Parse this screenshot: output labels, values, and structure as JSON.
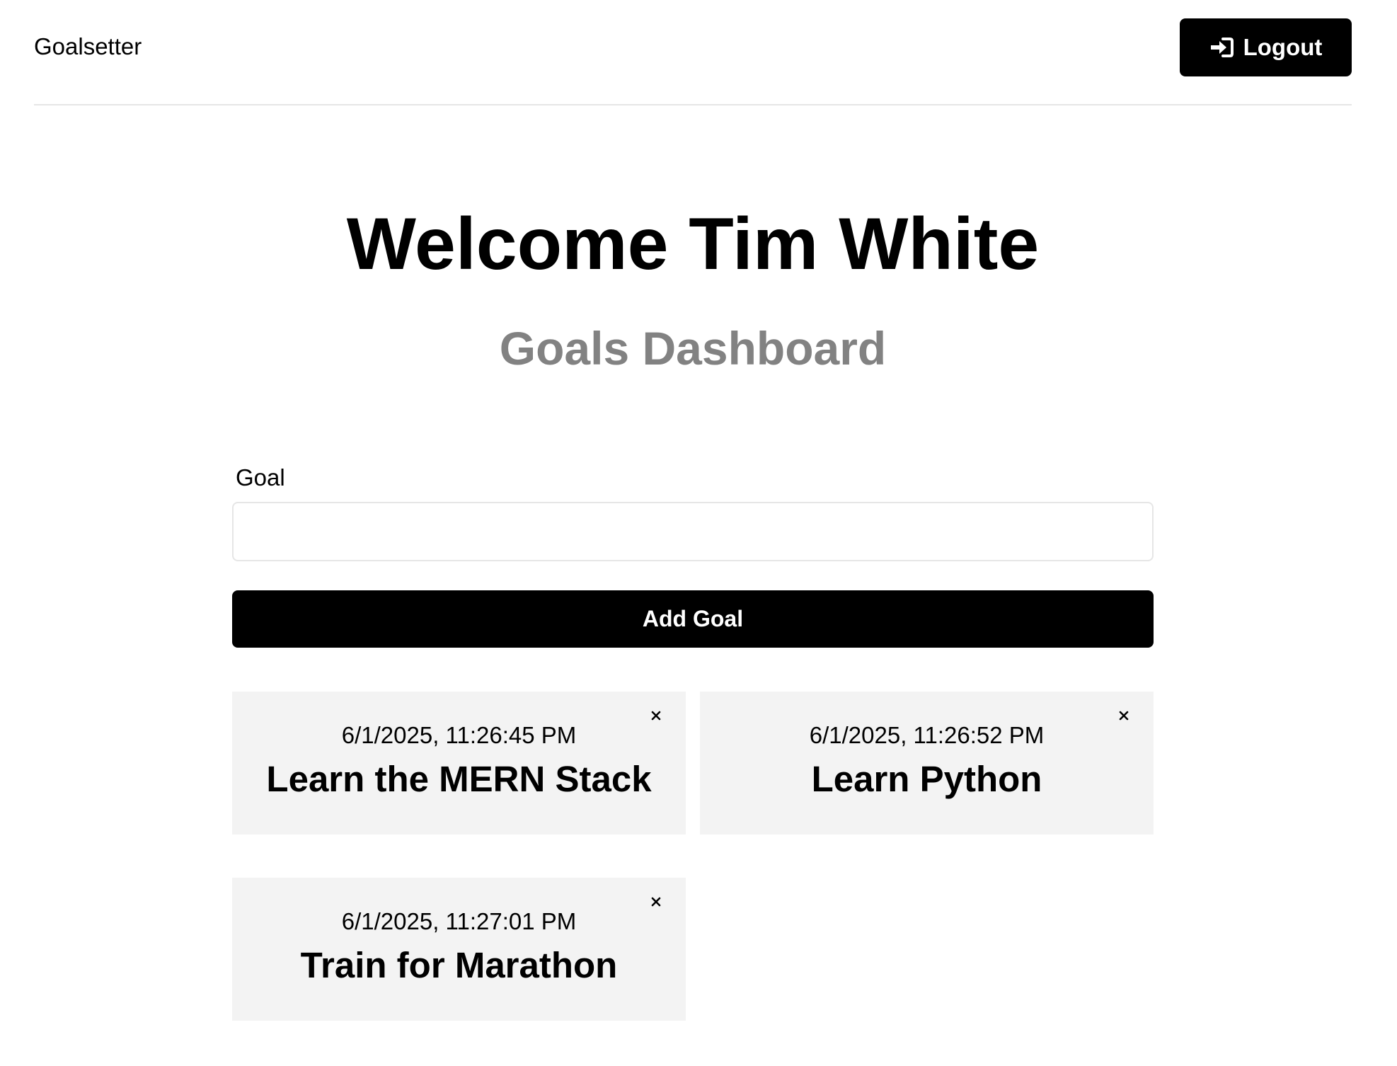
{
  "header": {
    "brand": "Goalsetter",
    "logout_label": "Logout",
    "logout_icon": "sign-in-icon"
  },
  "main": {
    "welcome": "Welcome Tim White",
    "subtitle": "Goals Dashboard"
  },
  "form": {
    "goal_label": "Goal",
    "goal_value": "",
    "add_button_label": "Add Goal"
  },
  "goals": [
    {
      "date": "6/1/2025, 11:26:45 PM",
      "text": "Learn the MERN Stack",
      "delete_icon": "close-icon"
    },
    {
      "date": "6/1/2025, 11:26:52 PM",
      "text": "Learn Python",
      "delete_icon": "close-icon"
    },
    {
      "date": "6/1/2025, 11:27:01 PM",
      "text": "Train for Marathon",
      "delete_icon": "close-icon"
    }
  ]
}
